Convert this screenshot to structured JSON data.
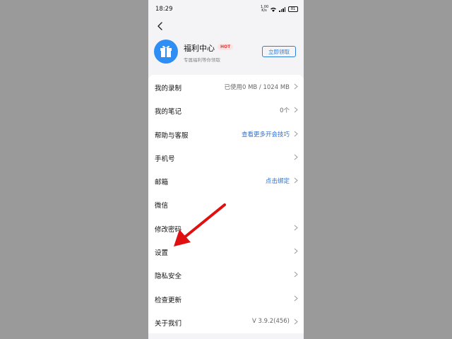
{
  "status": {
    "time": "18:29",
    "network": "1.00 K/s",
    "battery": "81"
  },
  "welfare": {
    "title": "福利中心",
    "badge": "HOT",
    "subtitle": "专属福利等你领取",
    "claim_label": "立即领取"
  },
  "menu": [
    {
      "label": "我的录制",
      "value": "已使用0 MB / 1024 MB",
      "link": false
    },
    {
      "label": "我的笔记",
      "value": "0个",
      "link": false
    },
    {
      "label": "帮助与客服",
      "value": "查看更多开会技巧",
      "link": true
    },
    {
      "label": "手机号",
      "value": "",
      "link": false
    },
    {
      "label": "邮箱",
      "value": "点击绑定",
      "link": true
    },
    {
      "label": "微信",
      "value": "",
      "link": false
    },
    {
      "label": "修改密码",
      "value": "",
      "link": false
    },
    {
      "label": "设置",
      "value": "",
      "link": false
    },
    {
      "label": "隐私安全",
      "value": "",
      "link": false
    },
    {
      "label": "检查更新",
      "value": "",
      "link": false
    },
    {
      "label": "关于我们",
      "value": "V 3.9.2(456)",
      "link": false
    }
  ],
  "colors": {
    "accent": "#2f8ef3",
    "link": "#2f6fcf",
    "annotation_arrow": "#e01010"
  }
}
